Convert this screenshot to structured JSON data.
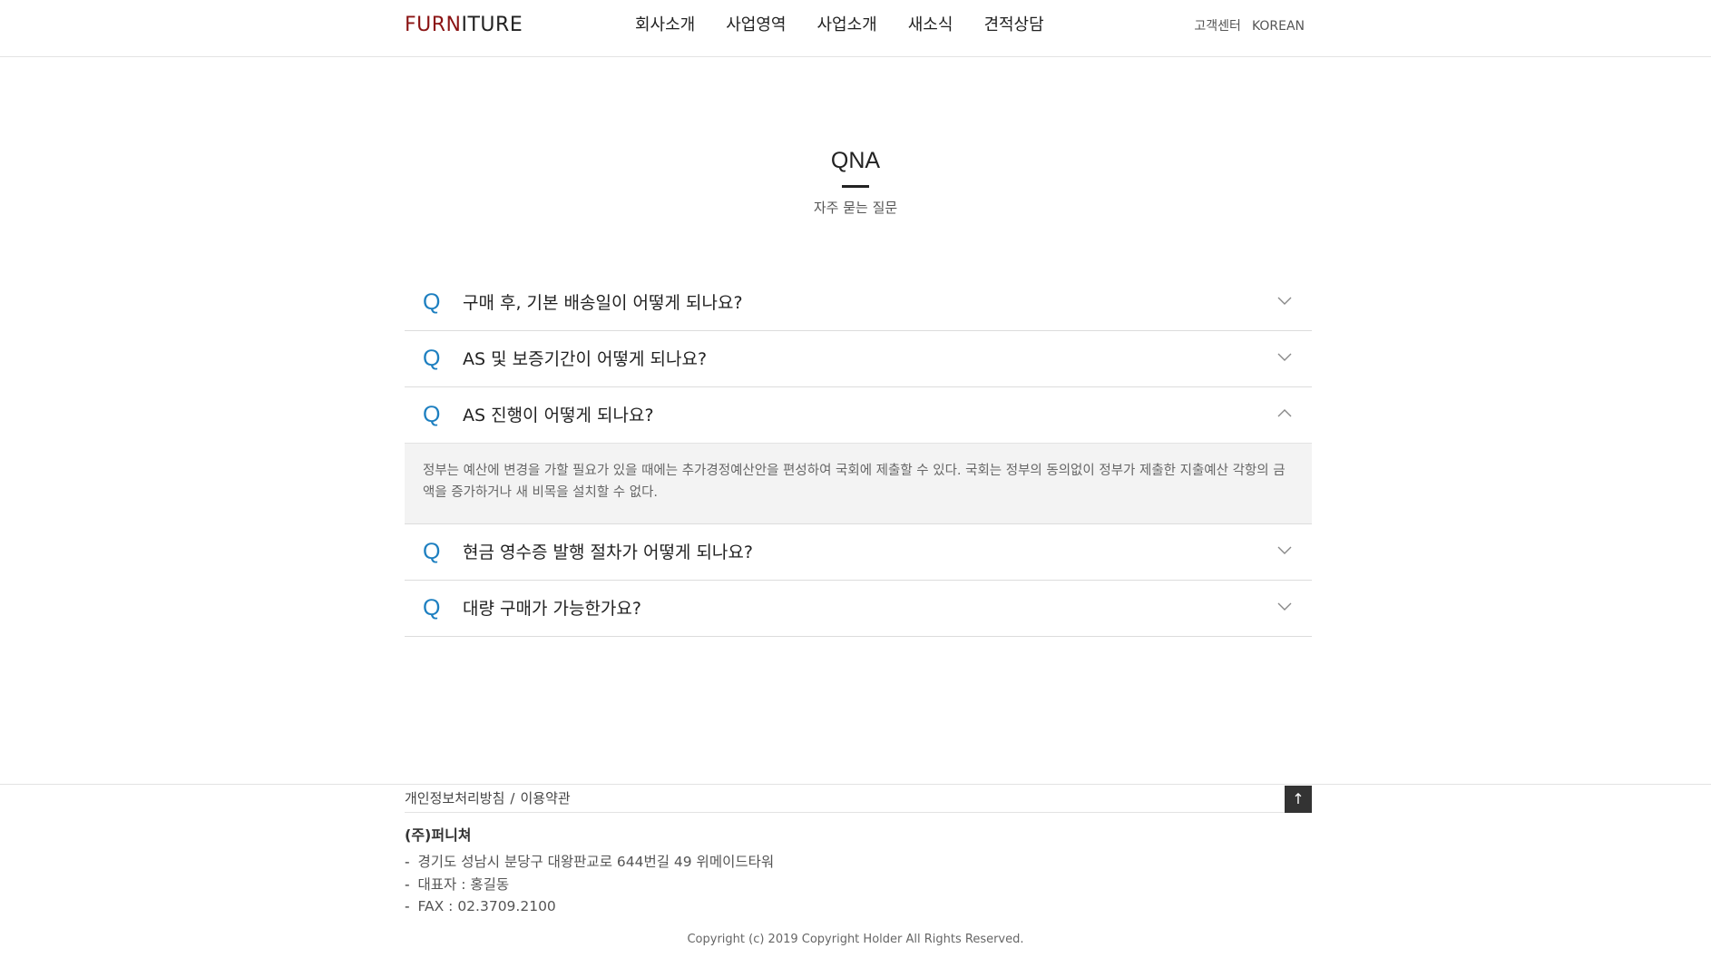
{
  "header": {
    "logo_prefix": "FURN",
    "logo_suffix": "ITURE",
    "nav": [
      "회사소개",
      "사업영역",
      "사업소개",
      "새소식",
      "견적상담"
    ],
    "util": [
      "고객센터",
      "KOREAN"
    ]
  },
  "page": {
    "title": "QNA",
    "subtitle": "자주 묻는 질문"
  },
  "faq": {
    "q_mark": "Q",
    "items": [
      {
        "question": "구매 후, 기본 배송일이 어떻게 되나요?",
        "expanded": false
      },
      {
        "question": "AS 및 보증기간이 어떻게 되나요?",
        "expanded": false
      },
      {
        "question": "AS 진행이 어떻게 되나요?",
        "expanded": true,
        "answer": "정부는 예산에 변경을 가할 필요가 있을 때에는 추가경정예산안을 편성하여 국회에 제출할 수 있다. 국회는 정부의 동의없이 정부가 제출한 지출예산 각항의 금액을 증가하거나 새 비목을 설치할 수 없다."
      },
      {
        "question": "현금 영수증 발행 절차가 어떻게 되나요?",
        "expanded": false
      },
      {
        "question": "대량 구매가 가능한가요?",
        "expanded": false
      }
    ]
  },
  "footer": {
    "privacy_label": "개인정보처리방침",
    "separator": "/",
    "terms_label": "이용약관",
    "top_label": "↑",
    "company": "(주)퍼니쳐",
    "info": [
      "경기도 성남시 분당구 대왕판교로 644번길 49 위메이드타워",
      "대표자 : 홍길동",
      "FAX : 02.3709.2100"
    ],
    "copyright": "Copyright (c) 2019 Copyright Holder All Rights Reserved."
  },
  "colors": {
    "accent_logo": "#8b1414",
    "q_mark": "#1d7fc0",
    "answer_bg": "#f3f3f3"
  }
}
